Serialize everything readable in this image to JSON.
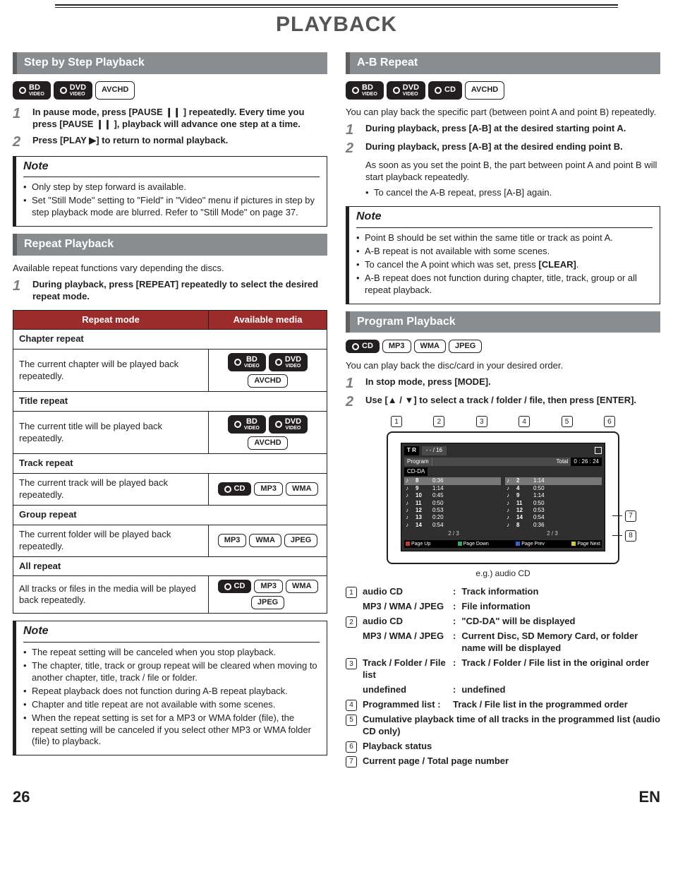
{
  "page": {
    "title": "PLAYBACK",
    "number": "26",
    "lang": "EN"
  },
  "badges": {
    "bd": "BD",
    "bd_sub": "VIDEO",
    "dvd": "DVD",
    "dvd_sub": "VIDEO",
    "avchd": "AVCHD",
    "cd": "CD",
    "mp3": "MP3",
    "wma": "WMA",
    "jpeg": "JPEG"
  },
  "stepByStep": {
    "header": "Step by Step Playback",
    "step1": "In pause mode, press [PAUSE ❙❙ ] repeatedly. Every time you press [PAUSE ❙❙ ], playback will advance one step at a time.",
    "step2": "Press [PLAY ▶] to return to normal playback.",
    "noteTitle": "Note",
    "notes": [
      "Only step by step forward is available.",
      "Set \"Still Mode\" setting to \"Field\" in \"Video\" menu if pictures in step by step playback mode are blurred. Refer to \"Still Mode\" on page 37."
    ]
  },
  "repeat": {
    "header": "Repeat Playback",
    "intro": "Available repeat functions vary depending the discs.",
    "step1": "During playback, press [REPEAT] repeatedly to select the desired repeat mode.",
    "th1": "Repeat mode",
    "th2": "Available media",
    "rows": [
      {
        "mode": "Chapter repeat",
        "desc": "The current chapter will be played back repeatedly.",
        "media": [
          "bd",
          "dvd",
          "avchd"
        ]
      },
      {
        "mode": "Title repeat",
        "desc": "The current title will be played back repeatedly.",
        "media": [
          "bd",
          "dvd",
          "avchd"
        ]
      },
      {
        "mode": "Track repeat",
        "desc": "The current track will be played back repeatedly.",
        "media": [
          "cd",
          "mp3",
          "wma"
        ]
      },
      {
        "mode": "Group repeat",
        "desc": "The current folder will be played back repeatedly.",
        "media": [
          "mp3",
          "wma",
          "jpeg"
        ]
      },
      {
        "mode": "All repeat",
        "desc": "All tracks or files in the media will be played back repeatedly.",
        "media": [
          "cd",
          "mp3",
          "wma",
          "jpeg"
        ]
      }
    ],
    "noteTitle": "Note",
    "notes": [
      "The repeat setting will be canceled when you stop playback.",
      "The chapter, title, track or group repeat will be cleared when moving to another chapter, title, track / file or folder.",
      "Repeat playback does not function during A-B repeat playback.",
      "Chapter and title repeat are not available with some scenes.",
      "When the repeat setting is set for a MP3 or WMA folder (file), the repeat setting will be canceled if you select other MP3 or WMA folder (file) to playback."
    ]
  },
  "ab": {
    "header": "A-B Repeat",
    "intro": "You can play back the specific part (between point A and point B) repeatedly.",
    "step1": "During playback, press [A-B] at the desired starting point A.",
    "step2": "During playback, press [A-B] at the desired ending point B.",
    "followup": "As soon as you set the point B, the part between point A and point B will start playback repeatedly.",
    "followbullet": "To cancel the A-B repeat, press [A-B] again.",
    "noteTitle": "Note",
    "notes": [
      "Point B should be set within the same title or track as point A.",
      "A-B repeat is not available with some scenes.",
      "To cancel the A point which was set, press [CLEAR].",
      "A-B repeat does not function during chapter, title, track, group or all repeat playback."
    ]
  },
  "program": {
    "header": "Program Playback",
    "intro": "You can play back the disc/card in your desired order.",
    "step1": "In stop mode, press [MODE].",
    "step2": "Use [▲ / ▼] to select a track / folder / file, then press [ENTER].",
    "diagram": {
      "tr": "T R",
      "count": "- - / 16",
      "programLabel": "Program",
      "totalLabel": "Total",
      "totalTime": "0 : 26 : 24",
      "cdda": "CD-DA",
      "left": [
        {
          "n": "8",
          "t": "0:36",
          "hl": true
        },
        {
          "n": "9",
          "t": "1:14"
        },
        {
          "n": "10",
          "t": "0:45"
        },
        {
          "n": "11",
          "t": "0:50"
        },
        {
          "n": "12",
          "t": "0:53"
        },
        {
          "n": "13",
          "t": "0:20"
        },
        {
          "n": "14",
          "t": "0:54"
        }
      ],
      "right": [
        {
          "n": "2",
          "t": "1:14",
          "hl": true
        },
        {
          "n": "4",
          "t": "0:50"
        },
        {
          "n": "9",
          "t": "1:14"
        },
        {
          "n": "11",
          "t": "0:50"
        },
        {
          "n": "12",
          "t": "0:53"
        },
        {
          "n": "14",
          "t": "0:54"
        },
        {
          "n": "8",
          "t": "0:36"
        }
      ],
      "pagerL": "2   /   3",
      "pagerR": "2   /   3",
      "f1": "Page Up",
      "f2": "Page Down",
      "f3": "Page Prev",
      "f4": "Page Next",
      "caption": "e.g.) audio CD"
    },
    "legend": [
      {
        "num": "1",
        "label1": "audio CD",
        "desc1": "Track information",
        "label2": "MP3 / WMA / JPEG",
        "desc2": "File information"
      },
      {
        "num": "2",
        "label1": "audio CD",
        "desc1": "\"CD-DA\" will be displayed",
        "label2": "MP3 / WMA / JPEG",
        "desc2": "Current Disc, SD Memory Card, or folder name will be displayed"
      },
      {
        "num": "3",
        "label1": "Track / Folder / File list",
        "desc1": "Track / Folder / File list in the original order"
      },
      {
        "num": "4",
        "label1": "Programmed list :",
        "desc1": "Track / File list in the programmed order",
        "inline": true
      },
      {
        "num": "5",
        "single": "Cumulative playback time of all tracks in the programmed list (audio CD only)"
      },
      {
        "num": "6",
        "single": "Playback status"
      },
      {
        "num": "7",
        "single": "Current page / Total page number"
      }
    ]
  }
}
